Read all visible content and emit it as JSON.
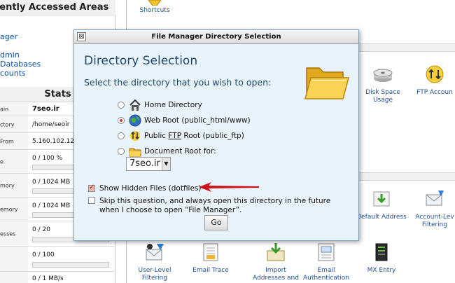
{
  "left_panel": {
    "frequently_accessed_title": "uently Accessed Areas",
    "frequent_items": [
      "ager",
      "",
      "dmin",
      "Databases",
      "counts"
    ],
    "stats_title": "Stats",
    "stats": [
      {
        "label": "ain",
        "value": "7seo.ir",
        "bold": true,
        "bar": false
      },
      {
        "label": "ctory",
        "value": "/home/seoir",
        "bold": false,
        "bar": false
      },
      {
        "label": "From",
        "value": "5.160.102.12",
        "bold": false,
        "bar": false
      },
      {
        "label": "e",
        "value": "0 / 100 %",
        "bold": false,
        "bar": true
      },
      {
        "label": "mory",
        "value": "0 / 1024 MB",
        "bold": false,
        "bar": true
      },
      {
        "label": "emory",
        "value": "0 / 1024 MB",
        "bold": false,
        "bar": true
      },
      {
        "label": "esses",
        "value": "0 / 20",
        "bold": false,
        "bar": true
      },
      {
        "label": "",
        "value": "0 / 100",
        "bold": false,
        "bar": true
      },
      {
        "label": "",
        "value": "0 / 1 MB/s",
        "bold": false,
        "bar": false
      }
    ]
  },
  "right_panel": {
    "shortcuts_label": "Shortcuts",
    "files_items": [
      {
        "name": "disk-space-usage",
        "label_line1": "Disk Space",
        "label_line2": "Usage"
      },
      {
        "name": "ftp-accounts",
        "label_line1": "FTP Accoun",
        "label_line2": ""
      }
    ],
    "mail_items_top": [
      {
        "name": "default-address",
        "label_line1": "Default Address",
        "label_line2": ""
      },
      {
        "name": "account-level-filtering",
        "label_line1": "Account-Lev",
        "label_line2": "Filtering"
      }
    ],
    "mail_items_bottom": [
      {
        "name": "user-level-filtering",
        "label_line1": "User-Level",
        "label_line2": "Filtering"
      },
      {
        "name": "email-trace",
        "label_line1": "Email Trace",
        "label_line2": ""
      },
      {
        "name": "import-addresses",
        "label_line1": "Import",
        "label_line2": "Addresses and"
      },
      {
        "name": "email-authentication",
        "label_line1": "Email",
        "label_line2": "Authentication"
      },
      {
        "name": "mx-entry",
        "label_line1": "MX Entry",
        "label_line2": ""
      }
    ]
  },
  "dialog": {
    "title": "File Manager Directory Selection",
    "close_glyph": "⊠",
    "heading": "Directory Selection",
    "subheading": "Select the directory that you wish to open:",
    "options": {
      "home": "Home Directory",
      "webroot": "Web Root (public_html/www)",
      "ftp_pre": "Public ",
      "ftp_u": "FTP",
      "ftp_post": " Root (public_ftp)",
      "docroot": "Document Root for:"
    },
    "selected_option": "webroot",
    "domain_select_value": "7seo.ir",
    "show_hidden_label": "Show Hidden Files (dotfiles)",
    "show_hidden_checked": true,
    "skip_label": "Skip this question, and always open this directory in the future when I choose to open “File Manager”.",
    "skip_checked": false,
    "go_label": "Go"
  },
  "colors": {
    "dialog_bg": "#e9f3fb",
    "heading": "#204a6e",
    "link": "#1e4f99",
    "annotation_arrow": "#d0101a"
  }
}
